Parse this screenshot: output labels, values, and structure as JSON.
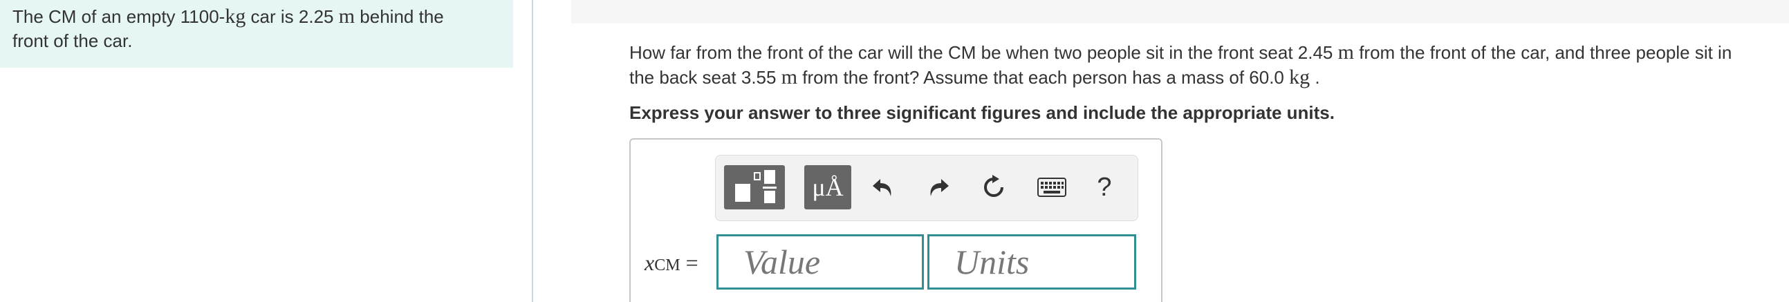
{
  "intro": {
    "part1": "The CM of an empty 1100-",
    "unit_kg": "kg",
    "part2": " car is 2.25 ",
    "unit_m": "m",
    "part3": " behind the",
    "line2": "front of the car."
  },
  "question": {
    "line1_a": "How far from the front of the car will the CM be when two people sit in the front seat 2.45 ",
    "line1_unit": "m",
    "line1_b": " from the front of the car, and three people sit in",
    "line2_a": "the back seat 3.55 ",
    "line2_unit": "m",
    "line2_b": " from the front? Assume that each person has a mass of 60.0 ",
    "line2_unit2": "kg",
    "line2_c": " ."
  },
  "instruction": "Express your answer to three significant figures and include the appropriate units.",
  "toolbar": {
    "templates_icon": "templates-icon",
    "symbols_label": "μÅ",
    "undo_icon": "undo-icon",
    "redo_icon": "redo-icon",
    "reset_icon": "reset-icon",
    "keyboard_icon": "keyboard-icon",
    "help_label": "?"
  },
  "answer": {
    "variable": "x",
    "subscript": "CM",
    "equals": " =",
    "value_placeholder": "Value",
    "units_placeholder": "Units",
    "value": "",
    "units": ""
  },
  "colors": {
    "intro_bg": "#e5f6f5",
    "field_border": "#2f8f94",
    "toolbar_dark": "#666666"
  }
}
